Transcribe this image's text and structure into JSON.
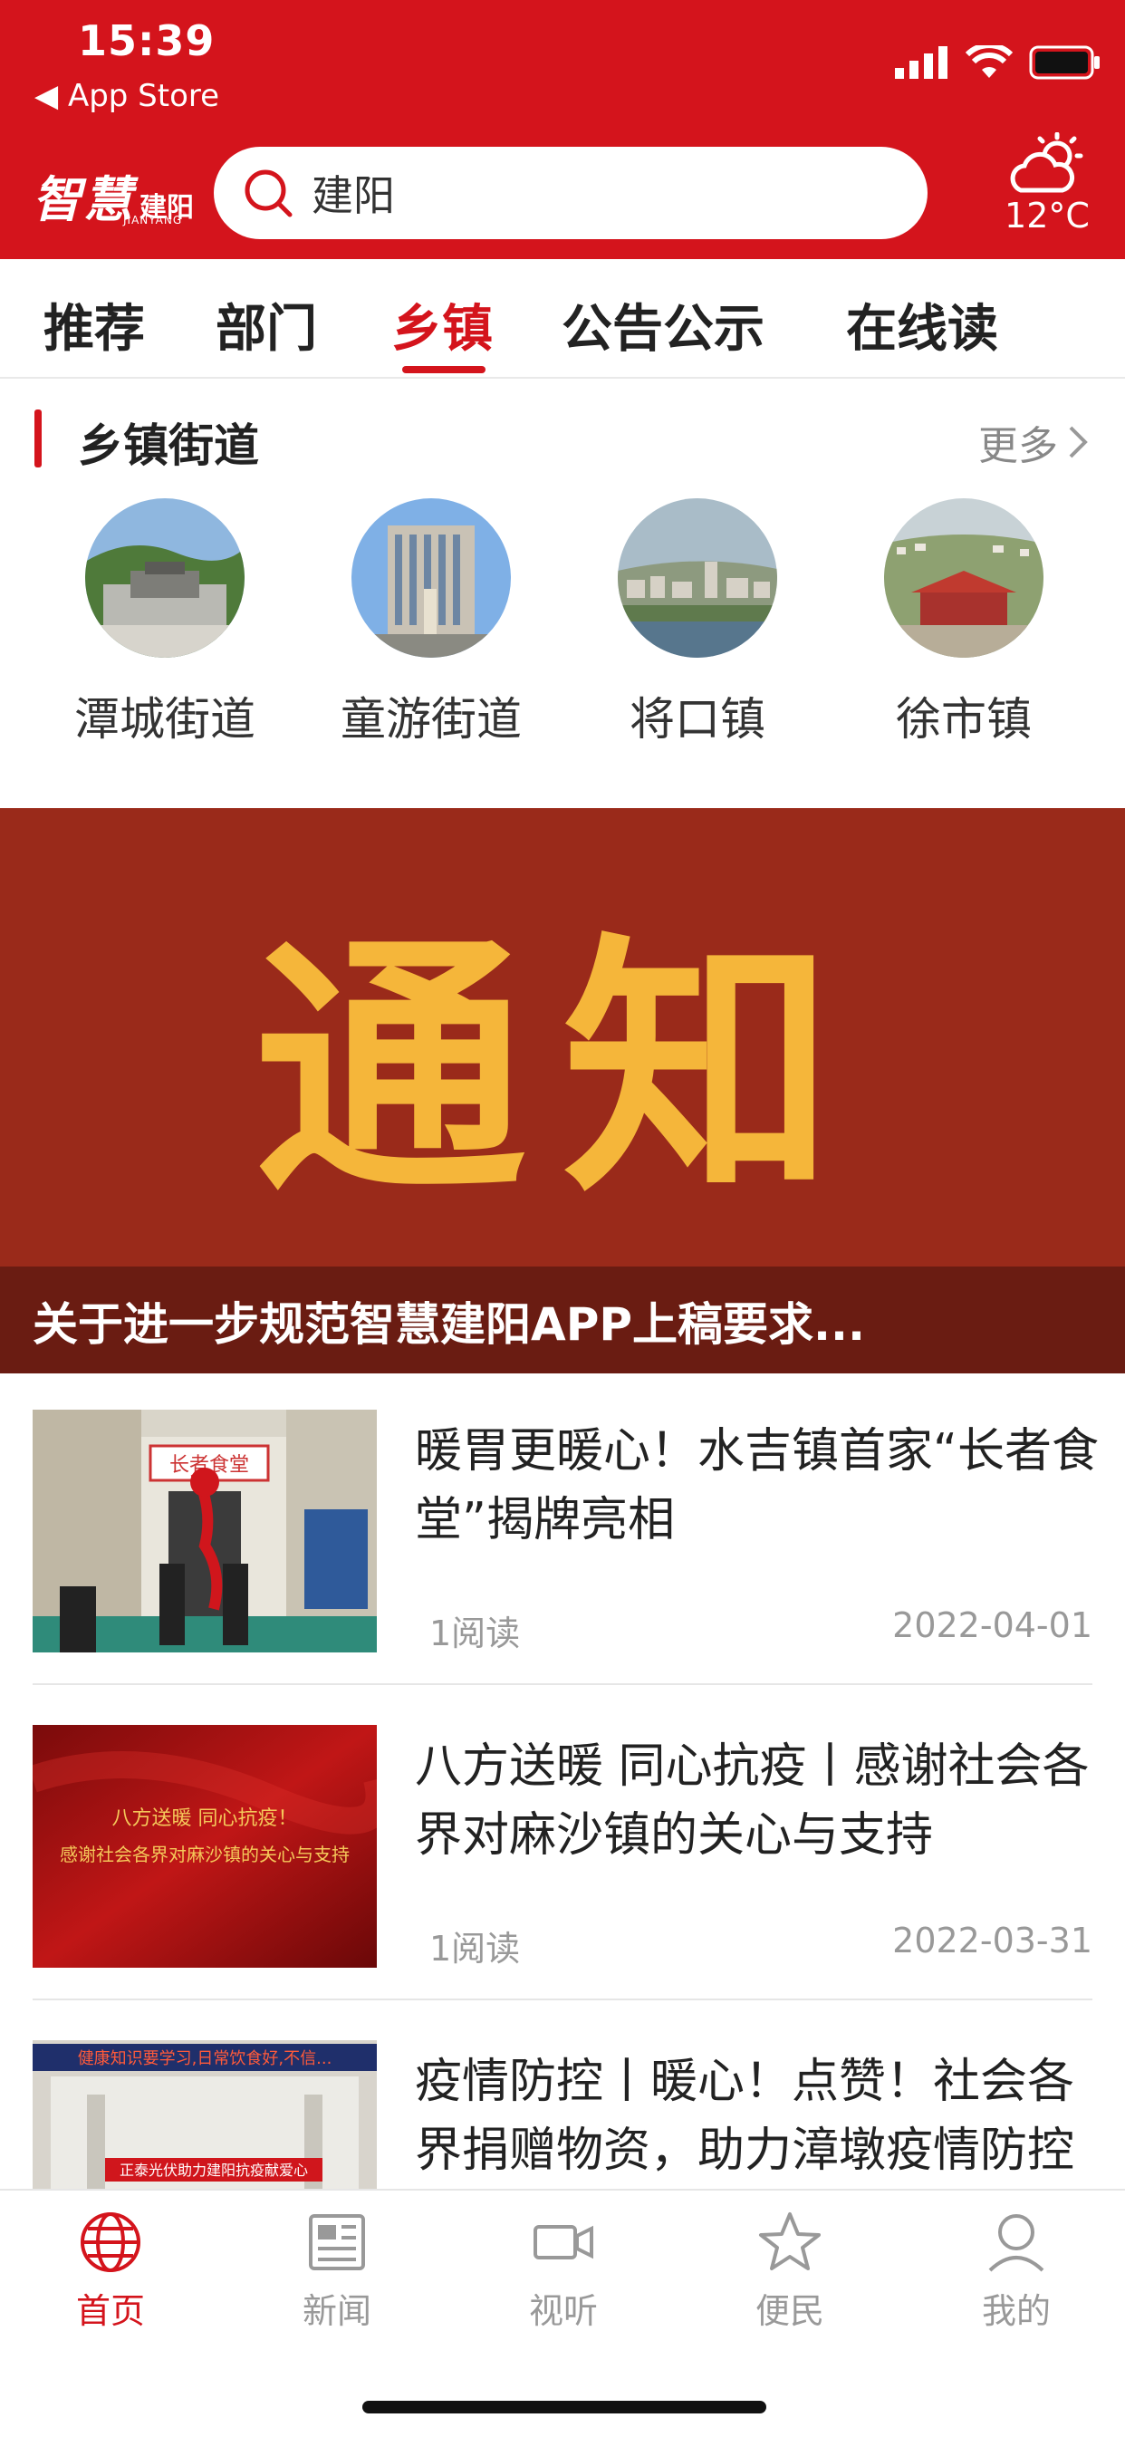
{
  "status": {
    "time": "15:39",
    "back_app": "◀ App Store"
  },
  "header": {
    "logo_main": "智慧",
    "logo_sub": "建阳",
    "logo_en": "JIANYANG",
    "search_value": "建阳",
    "weather_temp": "12°C",
    "accent_color": "#d4141c"
  },
  "tabs": [
    {
      "label": "推荐"
    },
    {
      "label": "部门"
    },
    {
      "label": "乡镇",
      "active": true
    },
    {
      "label": "公告公示"
    },
    {
      "label": "在线读"
    }
  ],
  "section": {
    "title": "乡镇街道",
    "more": "更多"
  },
  "towns": [
    {
      "name": "潭城街道"
    },
    {
      "name": "童游街道"
    },
    {
      "name": "将口镇"
    },
    {
      "name": "徐市镇"
    }
  ],
  "banner": {
    "big_text": "通知",
    "caption": "关于进一步规范智慧建阳APP上稿要求..."
  },
  "news": [
    {
      "title": "暖胃更暖心！水吉镇首家“长者食堂”揭牌亮相",
      "reads": "1阅读",
      "date": "2022-04-01",
      "thumb_sign": "长者食堂"
    },
    {
      "title": "八方送暖 同心抗疫丨感谢社会各界对麻沙镇的关心与支持",
      "reads": "1阅读",
      "date": "2022-03-31",
      "thumb_line1": "八方送暖 同心抗疫！",
      "thumb_line2": "感谢社会各界对麻沙镇的关心与支持"
    },
    {
      "title": "疫情防控丨暖心！点赞！社会各界捐赠物资，助力漳墩疫情防控",
      "reads": "",
      "date": "",
      "thumb_banner1": "健康知识要学习,日常饮食好,不信...",
      "thumb_banner2": "正泰光伏助力建阳抗疫献爱心"
    }
  ],
  "bottom_nav": [
    {
      "label": "首页",
      "icon": "globe-icon",
      "active": true
    },
    {
      "label": "新闻",
      "icon": "newspaper-icon"
    },
    {
      "label": "视听",
      "icon": "video-icon"
    },
    {
      "label": "便民",
      "icon": "star-icon"
    },
    {
      "label": "我的",
      "icon": "user-icon"
    }
  ]
}
